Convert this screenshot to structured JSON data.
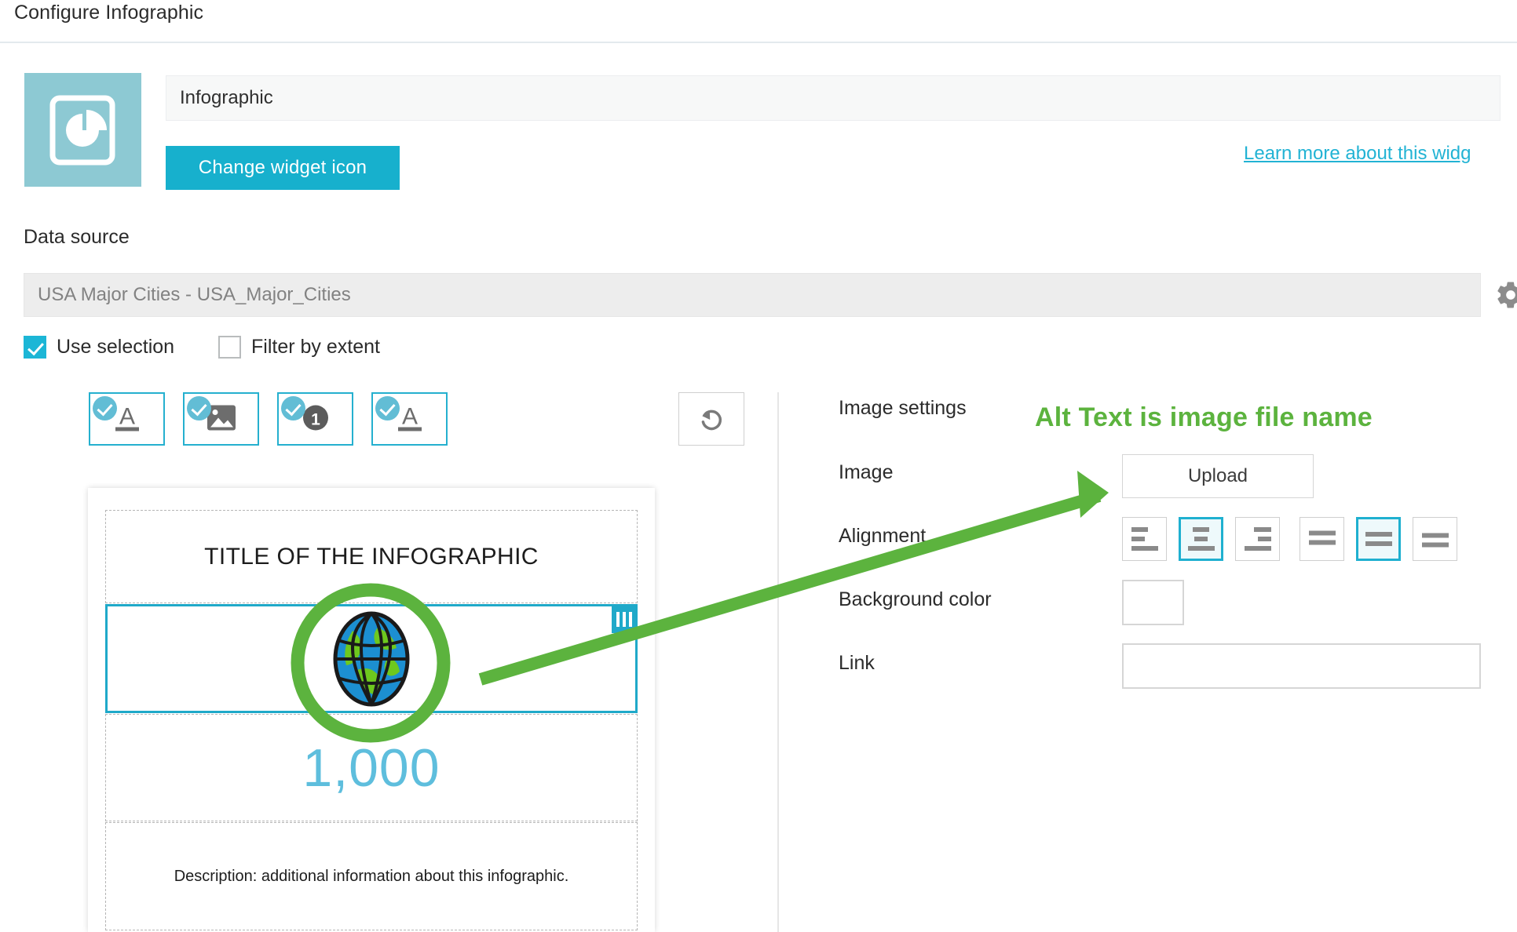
{
  "header": {
    "title": "Configure Infographic"
  },
  "widget": {
    "icon_name": "infographic-pie-chart-icon",
    "name_value": "Infographic",
    "name_placeholder": "Infographic",
    "change_icon_label": "Change widget icon",
    "learn_more_label": "Learn more about this widg",
    "accent_color": "#17b0cd",
    "icon_tile_color": "#8dc9d3"
  },
  "data_source": {
    "label": "Data source",
    "value": "USA Major Cities - USA_Major_Cities",
    "placeholder": "USA Major Cities - USA_Major_Cities",
    "settings_icon": "gear-icon",
    "checkboxes": [
      {
        "label": "Use selection",
        "checked": true
      },
      {
        "label": "Filter by extent",
        "checked": false
      }
    ]
  },
  "element_toolbar": {
    "buttons": [
      {
        "name": "title-element",
        "icon": "text-title-icon",
        "enabled": true
      },
      {
        "name": "image-element",
        "icon": "image-icon",
        "enabled": true
      },
      {
        "name": "number-element",
        "icon": "number-circle-icon",
        "enabled": true
      },
      {
        "name": "description-element",
        "icon": "text-description-icon",
        "enabled": true
      }
    ],
    "reset": {
      "name": "reset-button",
      "icon": "reset-arrow-icon"
    }
  },
  "preview": {
    "title": "TITLE OF THE INFOGRAPHIC",
    "image_alt": "globe-image",
    "number": "1,000",
    "description": "Description: additional information about this infographic.",
    "selected_section": "image",
    "drag_handle": "drag-handle-icon"
  },
  "image_settings": {
    "panel_title": "Image settings",
    "image_label": "Image",
    "upload_label": "Upload",
    "alignment_label": "Alignment",
    "alignment_options": [
      {
        "name": "align-left",
        "active": false
      },
      {
        "name": "align-center",
        "active": true
      },
      {
        "name": "align-right",
        "active": false
      },
      {
        "name": "align-top",
        "active": false
      },
      {
        "name": "align-middle",
        "active": true
      },
      {
        "name": "align-bottom",
        "active": false
      }
    ],
    "background_color_label": "Background color",
    "background_color_value": "#ffffff",
    "link_label": "Link",
    "link_value": "",
    "link_placeholder": ""
  },
  "annotation": {
    "text": "Alt Text is image file name",
    "color": "#5cb33e"
  }
}
